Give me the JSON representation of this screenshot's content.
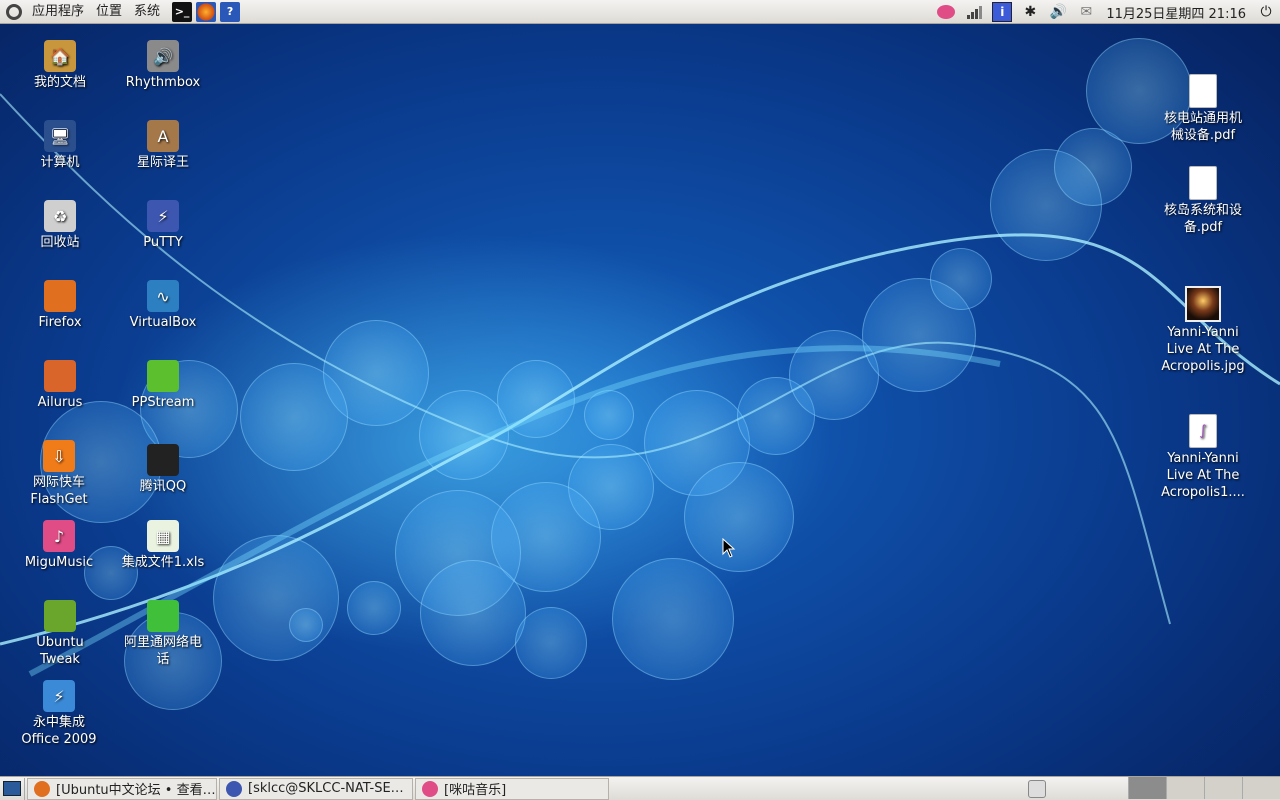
{
  "top_panel": {
    "menus": [
      "应用程序",
      "位置",
      "系统"
    ],
    "launchers": [
      {
        "name": "terminal-icon",
        "glyph": ">_"
      },
      {
        "name": "firefox-icon",
        "glyph": ""
      },
      {
        "name": "help-icon",
        "glyph": "?"
      }
    ],
    "clock": "11月25日星期四 21:16"
  },
  "desktop": {
    "left_icons": [
      {
        "label": "我的文档",
        "icon": "folder-icon",
        "color": "#c8963c",
        "glyph": "🏠"
      },
      {
        "label": "Rhythmbox",
        "icon": "rhythmbox-icon",
        "color": "#8a8a8a",
        "glyph": "🔊"
      },
      {
        "label": "计算机",
        "icon": "computer-icon",
        "color": "#2b4f8c",
        "glyph": "🖥"
      },
      {
        "label": "星际译王",
        "icon": "stardict-icon",
        "color": "#a5784a",
        "glyph": "A"
      },
      {
        "label": "回收站",
        "icon": "trash-icon",
        "color": "#cfcfcf",
        "glyph": "♻"
      },
      {
        "label": "PuTTY",
        "icon": "putty-icon",
        "color": "#3d56b0",
        "glyph": "⚡"
      },
      {
        "label": "Firefox",
        "icon": "firefox-icon",
        "color": "#e07020",
        "glyph": ""
      },
      {
        "label": "VirtualBox",
        "icon": "virtualbox-icon",
        "color": "#2c7fc1",
        "glyph": "∿"
      },
      {
        "label": "Ailurus",
        "icon": "ailurus-icon",
        "color": "#d9652a",
        "glyph": ""
      },
      {
        "label": "PPStream",
        "icon": "ppstream-icon",
        "color": "#5bbf2e",
        "glyph": ""
      },
      {
        "label": "网际快车\nFlashGet",
        "icon": "flashget-icon",
        "color": "#f07b19",
        "glyph": "⇩"
      },
      {
        "label": "腾讯QQ",
        "icon": "qq-icon",
        "color": "#222222",
        "glyph": ""
      },
      {
        "label": "MiguMusic",
        "icon": "migumusic-icon",
        "color": "#e04c86",
        "glyph": "♪"
      },
      {
        "label": "集成文件1.xls",
        "icon": "spreadsheet-icon",
        "color": "#e9f3e0",
        "glyph": "▦"
      },
      {
        "label": "Ubuntu\nTweak",
        "icon": "ubuntu-tweak-icon",
        "color": "#6aa62c",
        "glyph": ""
      },
      {
        "label": "阿里通网络电\n话",
        "icon": "alitong-icon",
        "color": "#3fbf3a",
        "glyph": ""
      },
      {
        "label": "永中集成\nOffice 2009",
        "icon": "yozo-office-icon",
        "color": "#3a8ad8",
        "glyph": "⚡"
      }
    ],
    "right_icons": [
      {
        "label": "核电站通用机\n械设备.pdf",
        "icon": "pdf-icon"
      },
      {
        "label": "核岛系统和设\n备.pdf",
        "icon": "pdf-icon"
      },
      {
        "label": "Yanni-Yanni\nLive At The\nAcropolis.jpg",
        "icon": "image-thumbnail-icon"
      },
      {
        "label": "Yanni-Yanni\nLive At The\nAcropolis1....",
        "icon": "audio-file-icon"
      }
    ]
  },
  "taskbar": {
    "tasks": [
      {
        "label": "[Ubuntu中文论坛 • 查看…",
        "icon": "firefox-icon",
        "color": "#e07020"
      },
      {
        "label": "[sklcc@SKLCC-NAT-SE…",
        "icon": "putty-icon",
        "color": "#3d56b0"
      },
      {
        "label": "[咪咕音乐]",
        "icon": "migumusic-icon",
        "color": "#e04c86"
      }
    ],
    "workspaces": 4
  }
}
